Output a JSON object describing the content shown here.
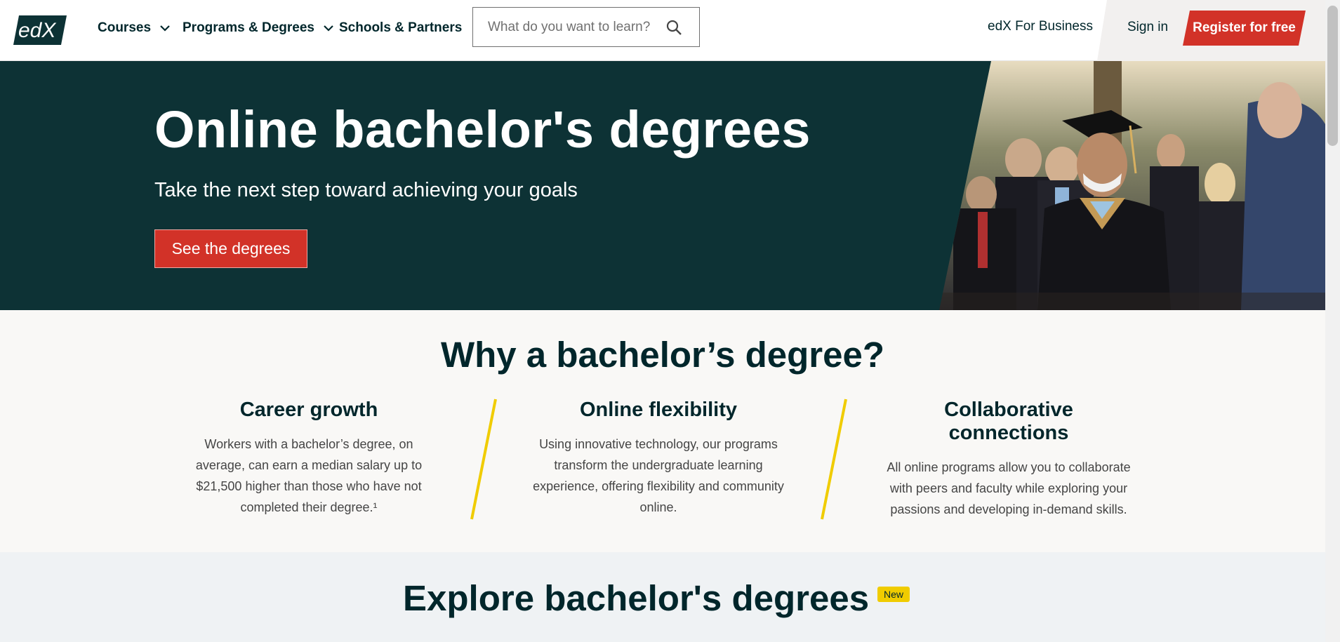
{
  "header": {
    "logo_text": "edX",
    "nav": [
      {
        "label": "Courses",
        "has_dropdown": true
      },
      {
        "label": "Programs & Degrees",
        "has_dropdown": true
      },
      {
        "label": "Schools & Partners",
        "has_dropdown": false
      }
    ],
    "search": {
      "placeholder": "What do you want to learn?",
      "value": ""
    },
    "business_link": "edX For Business",
    "sign_in": "Sign in",
    "register": "Register for free"
  },
  "hero": {
    "title": "Online bachelor's degrees",
    "subtitle": "Take the next step toward achieving your goals",
    "cta": "See the degrees"
  },
  "why": {
    "title": "Why a bachelor’s degree?",
    "columns": [
      {
        "heading": "Career growth",
        "text": "Workers with a bachelor’s degree, on average, can earn a median salary up to $21,500 higher than those who have not completed their degree.¹"
      },
      {
        "heading": "Online flexibility",
        "text": "Using innovative technology, our programs transform the undergraduate learning experience, offering flexibility and community online."
      },
      {
        "heading": "Collaborative connections",
        "text": "All online programs allow you to collaborate with peers and faculty while exploring your passions and developing in-demand skills."
      }
    ]
  },
  "explore": {
    "title": "Explore bachelor's degrees",
    "badge": "New"
  },
  "colors": {
    "brand_red": "#d23228",
    "hero_bg": "#0d3235",
    "accent_yellow": "#f0cc00",
    "text_dark": "#00262b"
  },
  "icons": [
    "chevron-down-icon",
    "search-icon"
  ]
}
